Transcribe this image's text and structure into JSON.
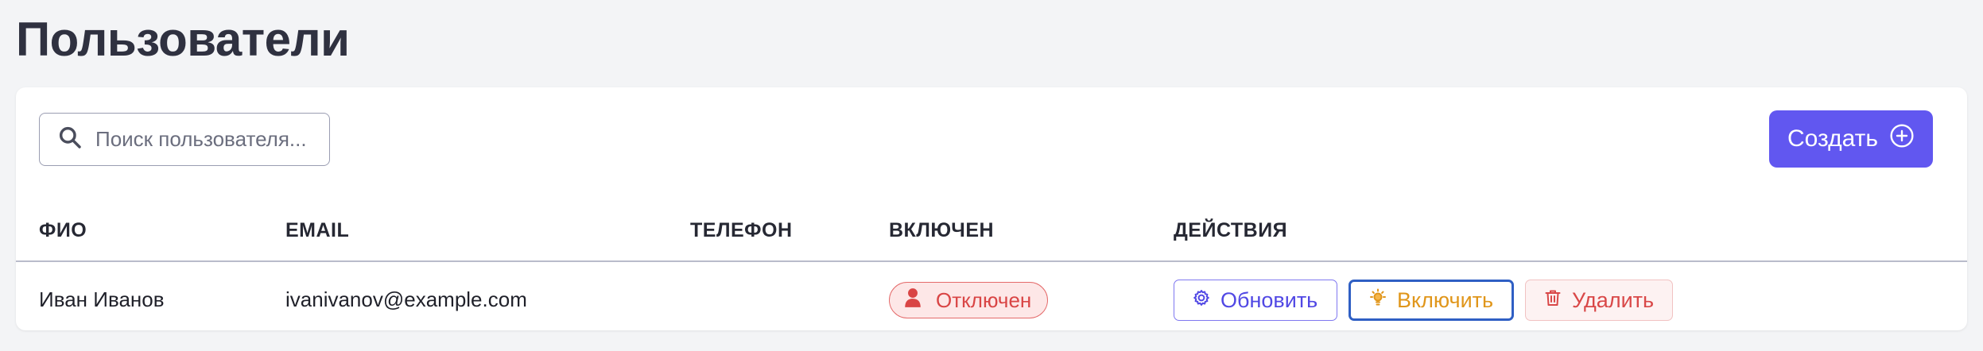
{
  "page": {
    "title": "Пользователи"
  },
  "toolbar": {
    "search_placeholder": "Поиск пользователя...",
    "search_icon": "search-icon",
    "create_label": "Создать",
    "create_icon": "plus-circle-icon"
  },
  "table": {
    "columns": [
      "ФИО",
      "EMAIL",
      "ТЕЛЕФОН",
      "ВКЛЮЧЕН",
      "ДЕЙСТВИЯ"
    ],
    "rows": [
      {
        "name": "Иван Иванов",
        "email": "ivanivanov@example.com",
        "phone": "",
        "status": "Отключен",
        "status_icon": "user-icon",
        "actions": {
          "update_label": "Обновить",
          "update_icon": "gear-icon",
          "enable_label": "Включить",
          "enable_icon": "lightbulb-icon",
          "delete_label": "Удалить",
          "delete_icon": "trash-icon"
        }
      }
    ]
  },
  "colors": {
    "accent": "#6157f0",
    "background": "#f3f4f6",
    "status_disabled": "#d94545",
    "update": "#5148e4",
    "enable": "#e0961b",
    "enable_border": "#2f5fc4",
    "delete": "#d94848"
  }
}
